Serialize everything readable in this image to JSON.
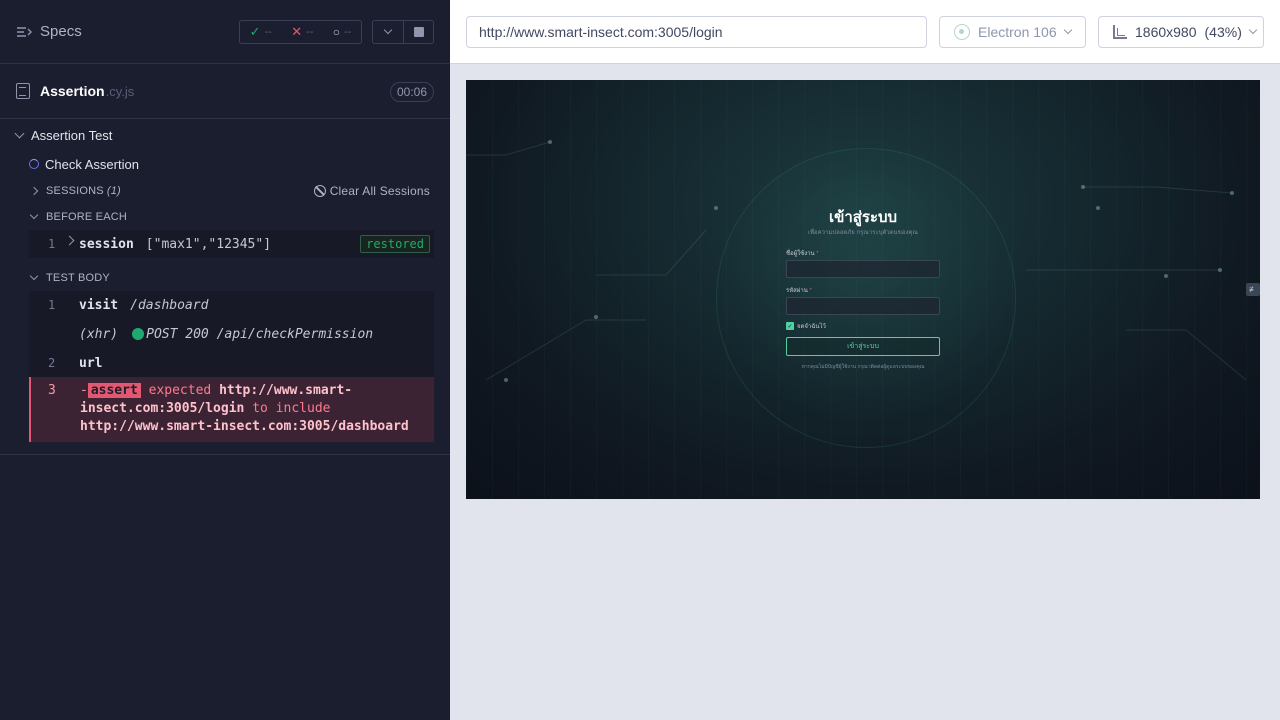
{
  "reporter": {
    "specs_label": "Specs",
    "stats": {
      "passed": "--",
      "failed": "--",
      "pending": "--"
    },
    "spec": {
      "name": "Assertion",
      "ext": ".cy.js",
      "duration": "00:06"
    },
    "suite": {
      "title": "Assertion Test"
    },
    "test": {
      "title": "Check Assertion"
    },
    "sessions": {
      "label": "SESSIONS",
      "count": "(1)",
      "clear_label": "Clear All Sessions"
    },
    "before_each": {
      "label": "BEFORE EACH",
      "commands": [
        {
          "num": "1",
          "name": "session",
          "message": "[\"max1\",\"12345\"]",
          "badge": "restored"
        }
      ]
    },
    "test_body": {
      "label": "TEST BODY",
      "commands": [
        {
          "num": "1",
          "name": "visit",
          "message": "/dashboard"
        },
        {
          "num": "",
          "name": "(xhr)",
          "message": "POST 200 /api/checkPermission"
        },
        {
          "num": "2",
          "name": "url",
          "message": ""
        }
      ],
      "error": {
        "num": "3",
        "prefix": "-",
        "tag": "assert",
        "expected": "expected",
        "actual_url": "http://www.smart-insect.com:3005/login",
        "verb": "to include",
        "expected_url": "http://www.smart-insect.com:3005/dashboard"
      }
    }
  },
  "aut": {
    "url": "http://www.smart-insect.com:3005/login",
    "browser": "Electron 106",
    "viewport": "1860x980",
    "zoom": "(43%)",
    "login": {
      "title": "เข้าสู่ระบบ",
      "subtitle": "เพื่อความปลอดภัย กรุณาระบุตัวตนของคุณ",
      "username_label": "ชื่อผู้ใช้งาน",
      "password_label": "รหัสผ่าน",
      "required_mark": "*",
      "remember_label": "จดจำฉันไว้",
      "submit_label": "เข้าสู่ระบบ",
      "help_text": "หากคุณไม่มีบัญชีผู้ใช้งาน กรุณาติดต่อผู้ดูแลระบบของคุณ"
    }
  },
  "colors": {
    "pass": "#1fa971",
    "fail": "#e45770",
    "accent": "#4fd1a4",
    "reporter_bg": "#1b1e2e",
    "aut_bg": "#e1e3ed"
  }
}
